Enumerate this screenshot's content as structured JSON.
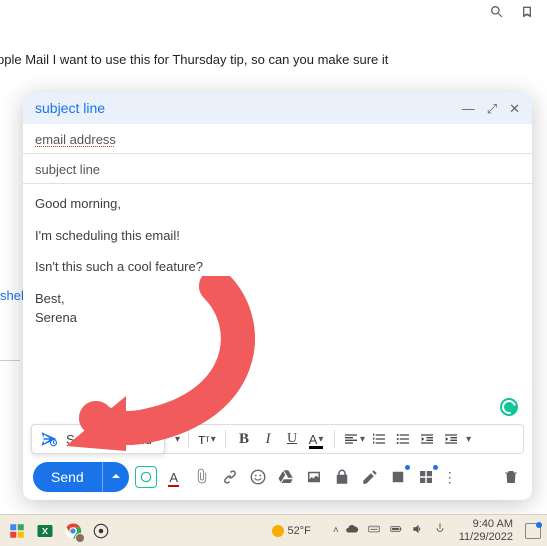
{
  "top": {},
  "background": {
    "article_text": "pple Mail I want to use this for Thursday tip, so can you make sure it",
    "link_text": "shelp"
  },
  "compose": {
    "header_title": "subject line",
    "to_value": "email address",
    "subject_value": "subject line",
    "body": {
      "p1": "Good morning,",
      "p2": "I'm scheduling this email!",
      "p3": "Isn't this such a cool feature?",
      "sig1": "Best,",
      "sig2": "Serena"
    },
    "schedule_send_label": "Schedule send",
    "send_label": "Send"
  },
  "taskbar": {
    "weather_temp": "52°F",
    "time": "9:40 AM",
    "date": "11/29/2022"
  }
}
